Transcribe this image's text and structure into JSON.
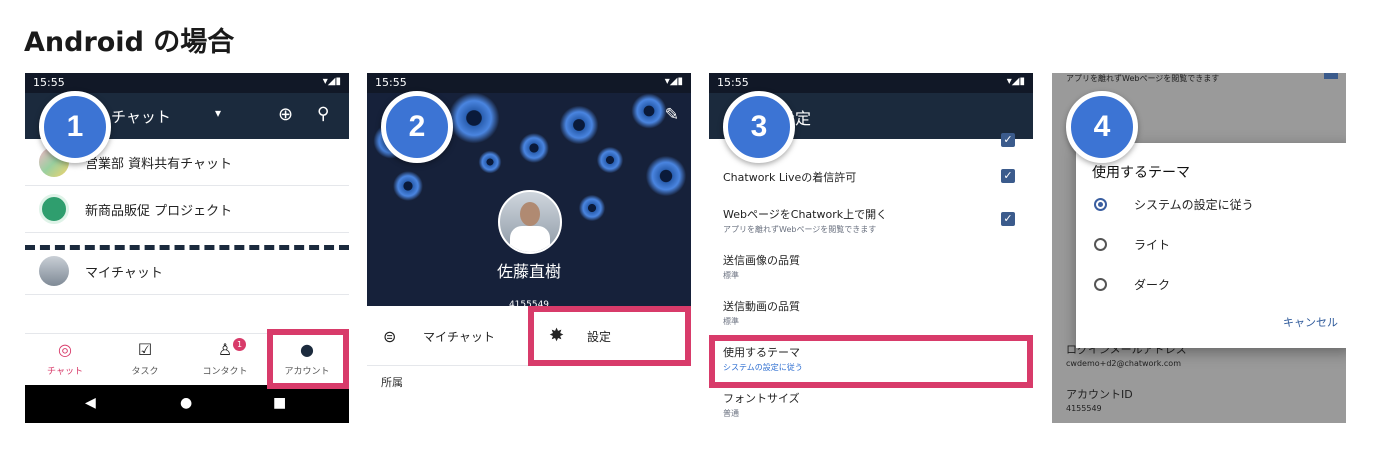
{
  "heading": "Android の場合",
  "status": {
    "time": "15:55",
    "icons": "▾◢▮"
  },
  "steps": [
    "1",
    "2",
    "3",
    "4"
  ],
  "panel1": {
    "appbar_title": "チャット",
    "rooms": [
      {
        "name": "営業部 資料共有チャット"
      },
      {
        "name": "新商品販促 プロジェクト"
      },
      {
        "name": "マイチャット"
      }
    ],
    "tabs": [
      {
        "label": "チャット",
        "icon": "chat-icon"
      },
      {
        "label": "タスク",
        "icon": "task-icon"
      },
      {
        "label": "コンタクト",
        "icon": "contact-icon",
        "badge": "1"
      },
      {
        "label": "アカウント",
        "icon": "account-icon"
      }
    ]
  },
  "panel2": {
    "name": "佐藤直樹",
    "id": "4155549",
    "my_chat": "マイチャット",
    "settings": "設定",
    "section": "所属"
  },
  "panel3": {
    "appbar_title": "設定",
    "settings": [
      {
        "title": "Chatwork Liveの着信許可",
        "checked": true
      },
      {
        "title": "WebページをChatwork上で開く",
        "sub": "アプリを離れずWebページを閲覧できます",
        "checked": true
      },
      {
        "title": "送信画像の品質",
        "sub": "標準"
      },
      {
        "title": "送信動画の品質",
        "sub": "標準"
      },
      {
        "title": "使用するテーマ",
        "sub": "システムの設定に従う"
      },
      {
        "title": "フォントサイズ",
        "sub": "普通"
      }
    ]
  },
  "panel4": {
    "top_text": "アプリを離れずWebページを閲覧できます",
    "dialog_title": "使用するテーマ",
    "options": [
      {
        "label": "システムの設定に従う",
        "selected": true
      },
      {
        "label": "ライト",
        "selected": false
      },
      {
        "label": "ダーク",
        "selected": false
      }
    ],
    "cancel": "キャンセル",
    "bottom": [
      {
        "title": "ログインメールアドレス",
        "sub": "cwdemo+d2@chatwork.com"
      },
      {
        "title": "アカウントID",
        "sub": "4155549"
      }
    ]
  },
  "colors": {
    "accent": "#d83b6a",
    "step": "#3c74d4",
    "appbar": "#1b2a3d"
  }
}
